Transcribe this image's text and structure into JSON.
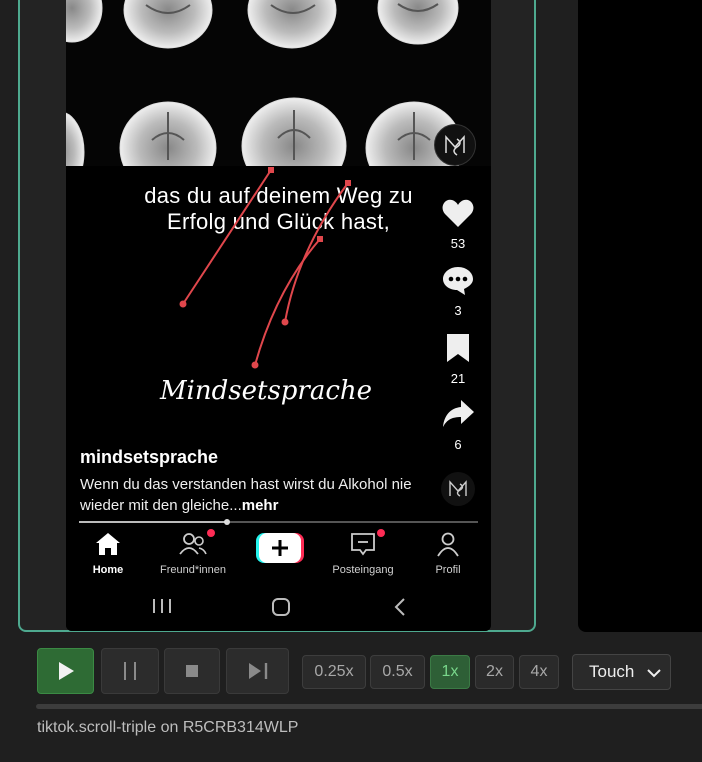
{
  "video": {
    "line1": "das du auf deinem Weg zu",
    "line2": "Erfolg und Glück hast,",
    "brand": "Mindsetsprache",
    "progress": 0.37
  },
  "rail": {
    "likes": "53",
    "comments": "3",
    "saves": "21",
    "shares": "6"
  },
  "post": {
    "username": "mindsetsprache",
    "caption": "Wenn du das verstanden hast wirst du Alkohol nie wieder mit den gleiche...",
    "more": "mehr"
  },
  "tabbar": {
    "home": "Home",
    "friends": "Freund*innen",
    "inbox": "Posteingang",
    "profile": "Profil"
  },
  "player": {
    "speeds": [
      "0.25x",
      "0.5x",
      "1x",
      "2x",
      "4x"
    ],
    "active_speed": "1x",
    "mode": "Touch",
    "status": "tiktok.scroll-triple on R5CRB314WLP"
  },
  "colors": {
    "accent_green": "#4ea98f",
    "play_green": "#2e6b34",
    "notification_red": "#fe2c55",
    "touch_trace": "#e0474c"
  },
  "icons": {
    "like": "heart-icon",
    "comment": "comment-icon",
    "save": "bookmark-icon",
    "share": "share-icon",
    "home": "home-icon",
    "friends": "friends-icon",
    "create": "plus-icon",
    "inbox": "inbox-icon",
    "profile": "person-icon"
  }
}
